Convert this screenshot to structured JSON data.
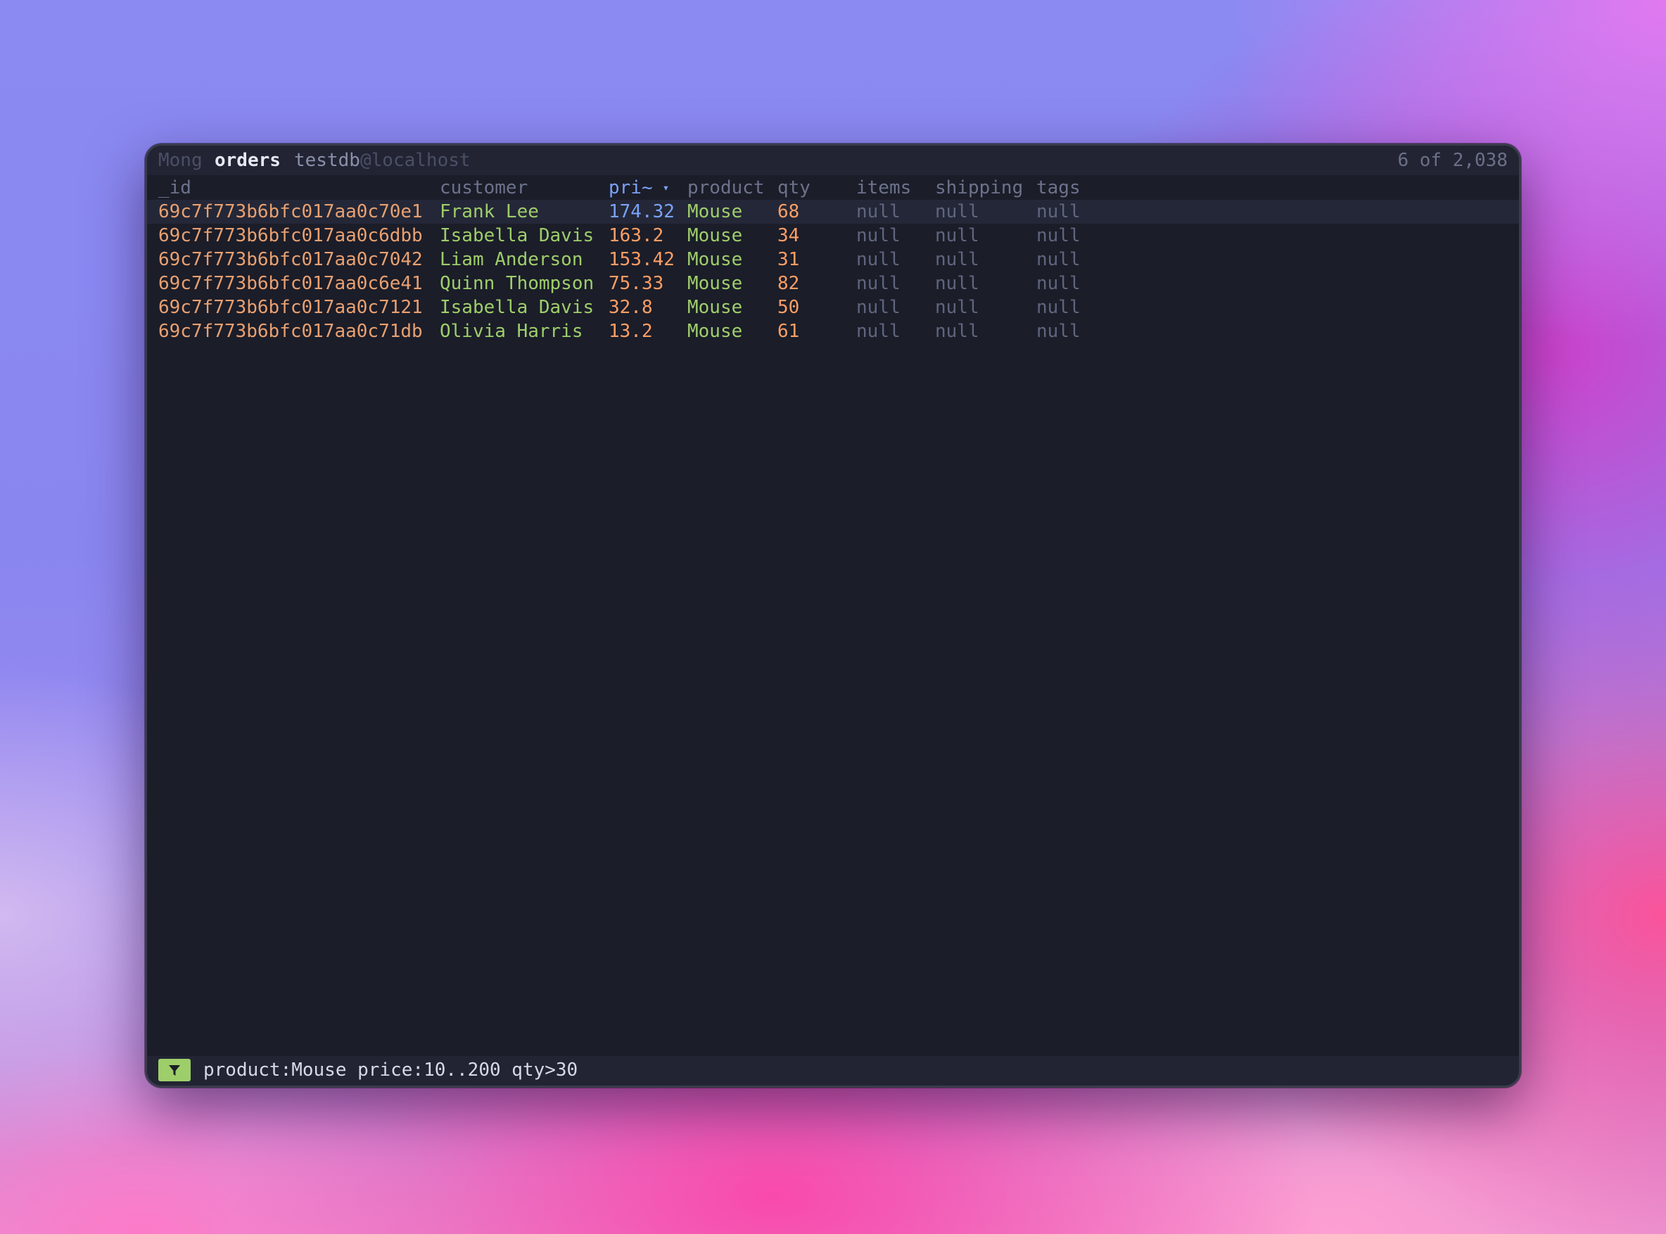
{
  "window": {
    "app_label": "Mong",
    "collection": "orders",
    "database": "testdb",
    "host": "@localhost",
    "record_count": "6 of 2,038"
  },
  "table": {
    "columns": [
      "_id",
      "customer",
      "pri~",
      "product",
      "qty",
      "items",
      "shipping",
      "tags"
    ],
    "sort_indicator": "▾",
    "rows": [
      [
        "69c7f773b6bfc017aa0c70e1",
        "Frank Lee",
        "174.32",
        "Mouse",
        "68",
        "null",
        "null",
        "null"
      ],
      [
        "69c7f773b6bfc017aa0c6dbb",
        "Isabella Davis",
        "163.2",
        "Mouse",
        "34",
        "null",
        "null",
        "null"
      ],
      [
        "69c7f773b6bfc017aa0c7042",
        "Liam Anderson",
        "153.42",
        "Mouse",
        "31",
        "null",
        "null",
        "null"
      ],
      [
        "69c7f773b6bfc017aa0c6e41",
        "Quinn Thompson",
        "75.33",
        "Mouse",
        "82",
        "null",
        "null",
        "null"
      ],
      [
        "69c7f773b6bfc017aa0c7121",
        "Isabella Davis",
        "32.8",
        "Mouse",
        "50",
        "null",
        "null",
        "null"
      ],
      [
        "69c7f773b6bfc017aa0c71db",
        "Olivia Harris",
        "13.2",
        "Mouse",
        "61",
        "null",
        "null",
        "null"
      ]
    ]
  },
  "status": {
    "filter_icon": "funnel-icon",
    "filter_query": "product:Mouse price:10..200 qty>30"
  },
  "colors": {
    "id": "#e8a070",
    "string": "#9ece6a",
    "number": "#ff9e64",
    "selected": "#7aa2f7",
    "null": "#5f657e",
    "filter_badge": "#9ece6a"
  }
}
